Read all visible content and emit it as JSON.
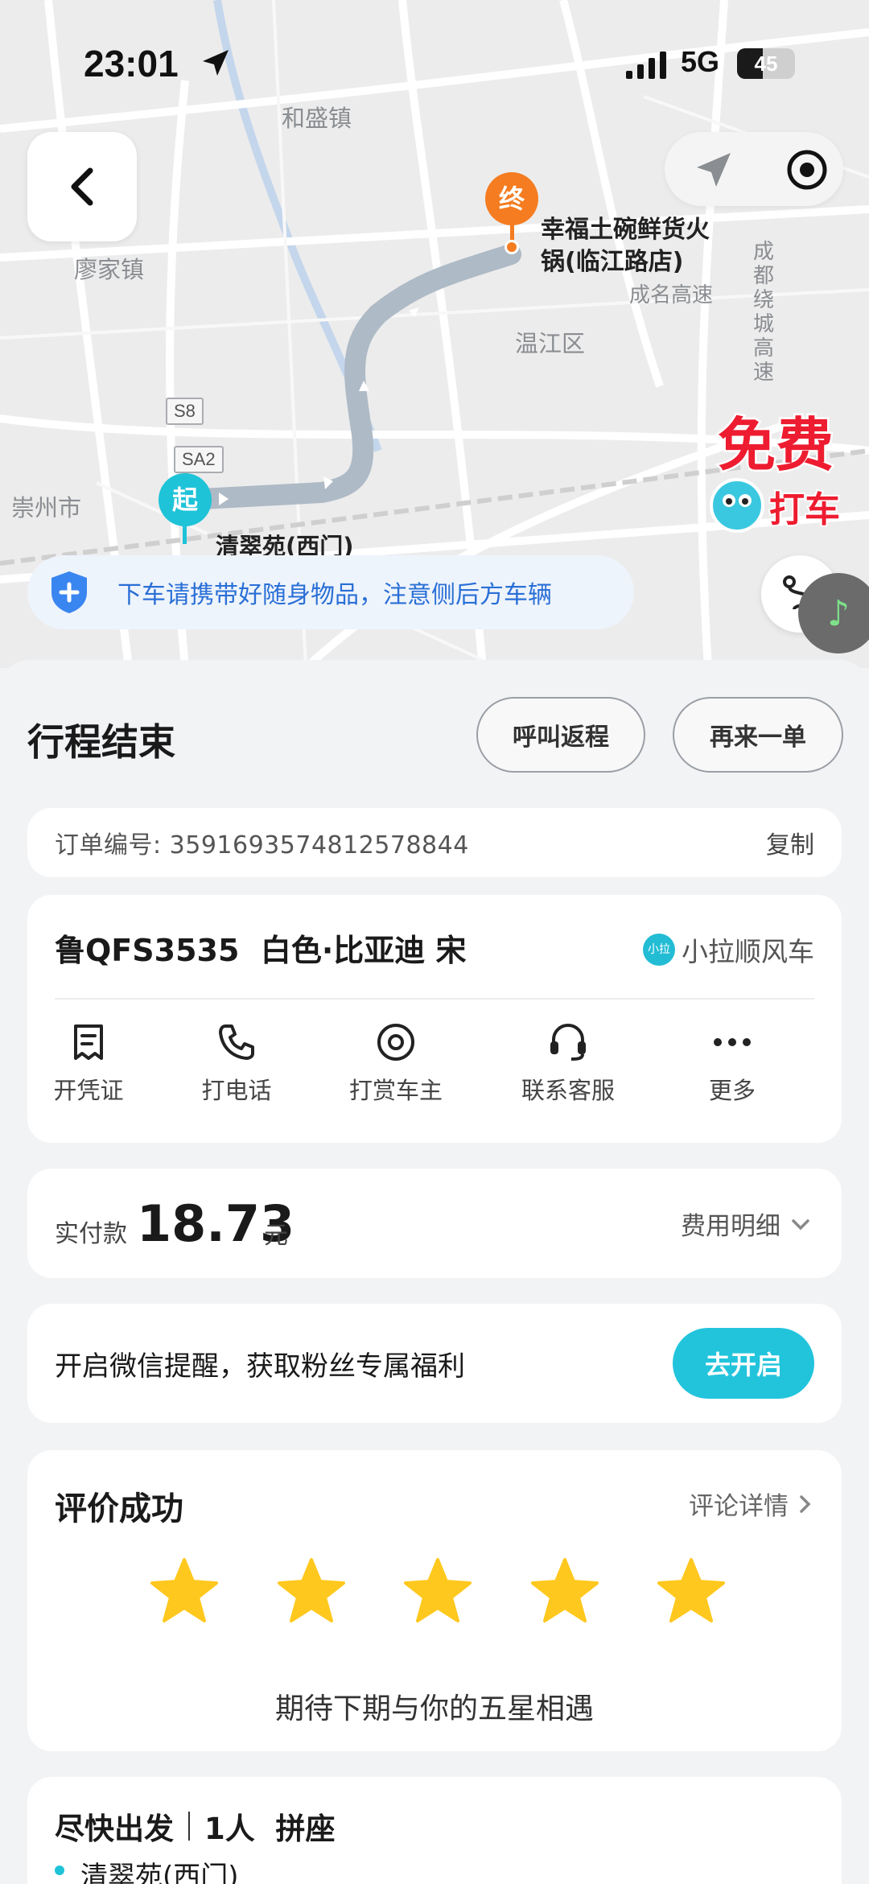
{
  "status_bar": {
    "time": "23:01",
    "network": "5G",
    "battery": "45",
    "battery_level": 0.45
  },
  "map": {
    "places": [
      "和盛镇",
      "廖家镇",
      "温江区",
      "崇州市"
    ],
    "roads": [
      "成名高速",
      "成都绕城高速"
    ],
    "highway_shields": [
      "S8",
      "SA2"
    ],
    "destination": {
      "marker": "终",
      "name_line1": "幸福土碗鲜货火",
      "name_line2": "锅(临江路店)"
    },
    "origin": {
      "marker": "起",
      "name": "清翠苑(西门)"
    },
    "promo": {
      "line1": "免费",
      "line2": "打车"
    },
    "notice": "下车请携带好随身物品，注意侧后方车辆",
    "route_color": "#aebac6"
  },
  "sheet": {
    "title": "行程结束",
    "return_button": "呼叫返程",
    "again_button": "再来一单",
    "order": {
      "label": "订单编号:",
      "number": "3591693574812578844",
      "copy": "复制"
    },
    "car": {
      "plate": "鲁QFS3535",
      "description": "白色·比亚迪 宋",
      "platform_badge": "小拉",
      "platform": "小拉顺风车"
    },
    "actions": [
      {
        "label": "开凭证",
        "icon": "receipt-icon"
      },
      {
        "label": "打电话",
        "icon": "phone-icon"
      },
      {
        "label": "打赏车主",
        "icon": "reward-icon"
      },
      {
        "label": "联系客服",
        "icon": "headset-icon"
      },
      {
        "label": "更多",
        "icon": "more-icon"
      }
    ],
    "payment": {
      "label": "实付款",
      "amount": "18.73",
      "unit": "元",
      "detail": "费用明细"
    },
    "wechat": {
      "text": "开启微信提醒，获取粉丝专属福利",
      "button": "去开启"
    },
    "rating": {
      "title": "评价成功",
      "detail": "评论详情",
      "stars": 5,
      "message": "期待下期与你的五星相遇"
    },
    "departure": {
      "time": "尽快出发",
      "seats": "1人",
      "type": "拼座",
      "origin": "清翠苑(西门)"
    }
  },
  "colors": {
    "accent": "#22c4dc",
    "end_marker": "#f57c20",
    "start_marker": "#1ec3d8",
    "star": "#ffc81e"
  }
}
